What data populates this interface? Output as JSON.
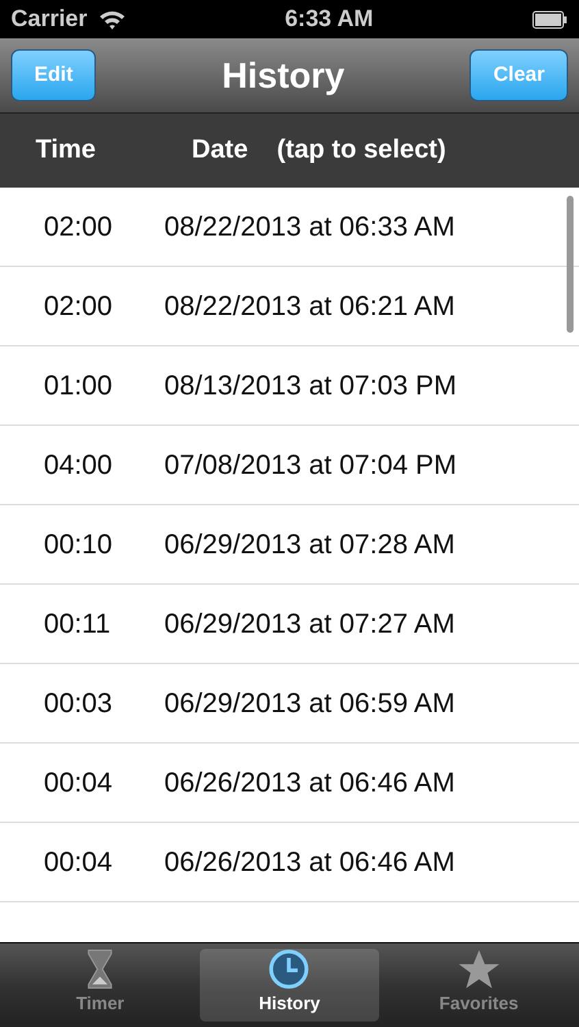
{
  "status_bar": {
    "carrier": "Carrier",
    "time": "6:33 AM"
  },
  "nav_bar": {
    "title": "History",
    "left_button": "Edit",
    "right_button": "Clear"
  },
  "table": {
    "columns": [
      "Time",
      "Date    (tap to select)"
    ],
    "rows": [
      {
        "time": "02:00",
        "date": "08/22/2013 at 06:33 AM"
      },
      {
        "time": "02:00",
        "date": "08/22/2013 at 06:21 AM"
      },
      {
        "time": "01:00",
        "date": "08/13/2013 at 07:03 PM"
      },
      {
        "time": "04:00",
        "date": "07/08/2013 at 07:04 PM"
      },
      {
        "time": "00:10",
        "date": "06/29/2013 at 07:28 AM"
      },
      {
        "time": "00:11",
        "date": "06/29/2013 at 07:27 AM"
      },
      {
        "time": "00:03",
        "date": "06/29/2013 at 06:59 AM"
      },
      {
        "time": "00:04",
        "date": "06/26/2013 at 06:46 AM"
      },
      {
        "time": "00:04",
        "date": "06/26/2013 at 06:46 AM"
      }
    ]
  },
  "tab_bar": [
    {
      "label": "Timer",
      "kind": "hourglass",
      "selected": false
    },
    {
      "label": "History",
      "kind": "clock",
      "selected": true
    },
    {
      "label": "Favorites",
      "kind": "star",
      "selected": false
    }
  ]
}
